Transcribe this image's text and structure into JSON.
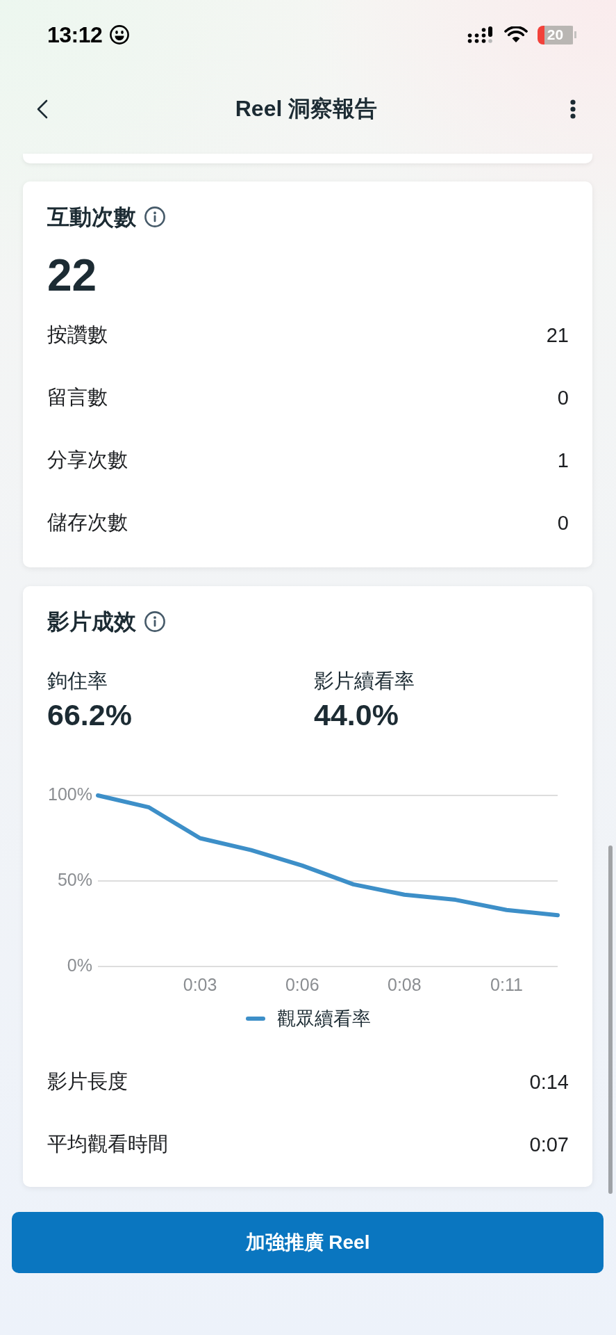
{
  "status_bar": {
    "time": "13:12",
    "battery": "20"
  },
  "header": {
    "title": "Reel 洞察報告"
  },
  "engagement": {
    "title": "互動次數",
    "total": "22",
    "rows": [
      {
        "label": "按讚數",
        "value": "21"
      },
      {
        "label": "留言數",
        "value": "0"
      },
      {
        "label": "分享次數",
        "value": "1"
      },
      {
        "label": "儲存次數",
        "value": "0"
      }
    ]
  },
  "video_performance": {
    "title": "影片成效",
    "stats": [
      {
        "label": "鉤住率",
        "value": "66.2%"
      },
      {
        "label": "影片續看率",
        "value": "44.0%"
      }
    ],
    "chart_data": {
      "type": "line",
      "x": [
        0,
        1.4,
        2.8,
        4.2,
        5.6,
        7,
        8.4,
        9.8,
        11.2,
        12.6
      ],
      "series": [
        {
          "name": "觀眾續看率",
          "color": "#3d8fc8",
          "values": [
            100,
            93,
            75,
            68,
            59,
            48,
            42,
            39,
            33,
            30
          ]
        }
      ],
      "xlim": [
        0,
        12.6
      ],
      "ylim": [
        0,
        100
      ],
      "xticks": [
        {
          "value": 2.8,
          "label": "0:03"
        },
        {
          "value": 5.6,
          "label": "0:06"
        },
        {
          "value": 8.4,
          "label": "0:08"
        },
        {
          "value": 11.2,
          "label": "0:11"
        }
      ],
      "yticks": [
        {
          "value": 0,
          "label": "0%"
        },
        {
          "value": 50,
          "label": "50%"
        },
        {
          "value": 100,
          "label": "100%"
        }
      ]
    },
    "rows": [
      {
        "label": "影片長度",
        "value": "0:14"
      },
      {
        "label": "平均觀看時間",
        "value": "0:07"
      }
    ]
  },
  "promote_button": {
    "label": "加強推廣 Reel"
  }
}
